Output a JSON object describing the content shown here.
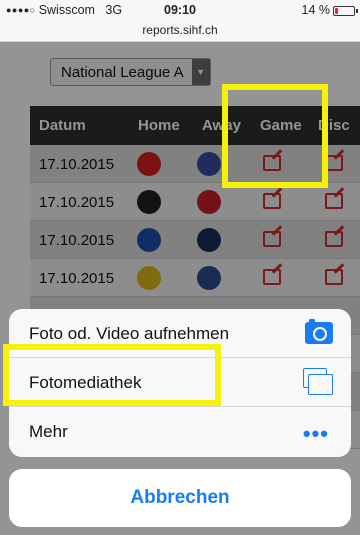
{
  "status_bar": {
    "carrier": "Swisscom",
    "network": "3G",
    "time": "09:10",
    "battery_text": "14 %",
    "battery_level": 0.14
  },
  "url": "reports.sihf.ch",
  "league_select": {
    "value": "National League A"
  },
  "table": {
    "columns": [
      "Datum",
      "Home",
      "Away",
      "Game",
      "Disc"
    ],
    "rows": [
      {
        "date": "17.10.2015"
      },
      {
        "date": "17.10.2015"
      },
      {
        "date": "17.10.2015"
      },
      {
        "date": "17.10.2015"
      }
    ]
  },
  "action_sheet": {
    "options": [
      {
        "label": "Foto od. Video aufnehmen",
        "icon": "camera-icon"
      },
      {
        "label": "Fotomediathek",
        "icon": "photo-library-icon"
      },
      {
        "label": "Mehr",
        "icon": "more-icon"
      }
    ],
    "cancel": "Abbrechen"
  },
  "colors": {
    "accent": "#1a7cf2",
    "highlight": "#f5f10a",
    "edit_icon": "#d42b2b"
  }
}
